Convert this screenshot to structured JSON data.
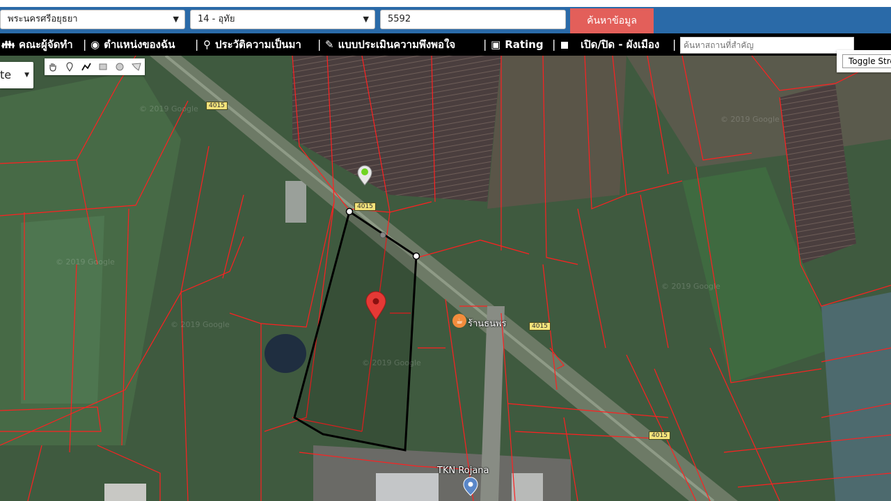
{
  "search": {
    "province": "พระนครศรีอยุธยา",
    "amphoe": "14 - อุทัย",
    "parcel_no": "5592",
    "button": "ค้นหาข้อมูล"
  },
  "nav": {
    "items": [
      {
        "label": "คณะผู้จัดทำ",
        "icon": "people-icon"
      },
      {
        "label": "ตำแหน่งของฉัน",
        "icon": "location-icon"
      },
      {
        "label": "ประวัติความเป็นมา",
        "icon": "history-icon"
      },
      {
        "label": "แบบประเมินความพึงพอใจ",
        "icon": "survey-icon"
      },
      {
        "label": "Rating",
        "icon": "chart-icon"
      },
      {
        "label": "เปิด/ปิด - ผังเมือง",
        "icon": "checkbox-icon"
      }
    ],
    "place_placeholder": "ค้นหาสถานที่สำคัญ"
  },
  "map": {
    "type_label": "te",
    "toggle_label": "Toggle Street View",
    "road_number": "4015",
    "poi_shop": "ร้านธนพร",
    "poi_factory": "TKN Rojana",
    "watermark": "© 2019 Google"
  },
  "colors": {
    "parcel_border": "#ff2020",
    "selected_polygon": "#000000",
    "search_button": "#e35f5a",
    "topbar": "#2a6aa8",
    "road_label": "#f3e27a"
  }
}
